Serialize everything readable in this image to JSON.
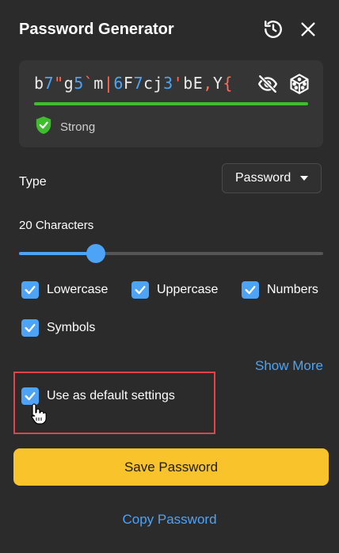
{
  "header": {
    "title": "Password Generator"
  },
  "password": {
    "segments": [
      {
        "t": "b",
        "k": "letter"
      },
      {
        "t": "7",
        "k": "digit"
      },
      {
        "t": "\"",
        "k": "sym"
      },
      {
        "t": "g",
        "k": "letter"
      },
      {
        "t": "5",
        "k": "digit"
      },
      {
        "t": "`",
        "k": "sym"
      },
      {
        "t": "m",
        "k": "letter"
      },
      {
        "t": "|",
        "k": "sym"
      },
      {
        "t": "6",
        "k": "digit"
      },
      {
        "t": "F",
        "k": "letter"
      },
      {
        "t": "7",
        "k": "digit"
      },
      {
        "t": "cj",
        "k": "letter"
      },
      {
        "t": "3",
        "k": "digit"
      },
      {
        "t": "'",
        "k": "sym"
      },
      {
        "t": "bE",
        "k": "letter"
      },
      {
        "t": ",",
        "k": "sym"
      },
      {
        "t": "Y",
        "k": "letter"
      },
      {
        "t": "{",
        "k": "sym"
      }
    ],
    "strength_label": "Strong"
  },
  "type": {
    "label": "Type",
    "selected": "Password"
  },
  "length": {
    "label": "20 Characters",
    "value": 20,
    "min": 4,
    "max": 128
  },
  "options": {
    "lowercase": "Lowercase",
    "uppercase": "Uppercase",
    "numbers": "Numbers",
    "symbols": "Symbols"
  },
  "show_more": "Show More",
  "default_settings": "Use as default settings",
  "save_button": "Save Password",
  "copy_link": "Copy Password",
  "colors": {
    "accent": "#4da3f5",
    "strong": "#3fbd2f",
    "save": "#f8c32b",
    "highlight": "#e0444a"
  }
}
